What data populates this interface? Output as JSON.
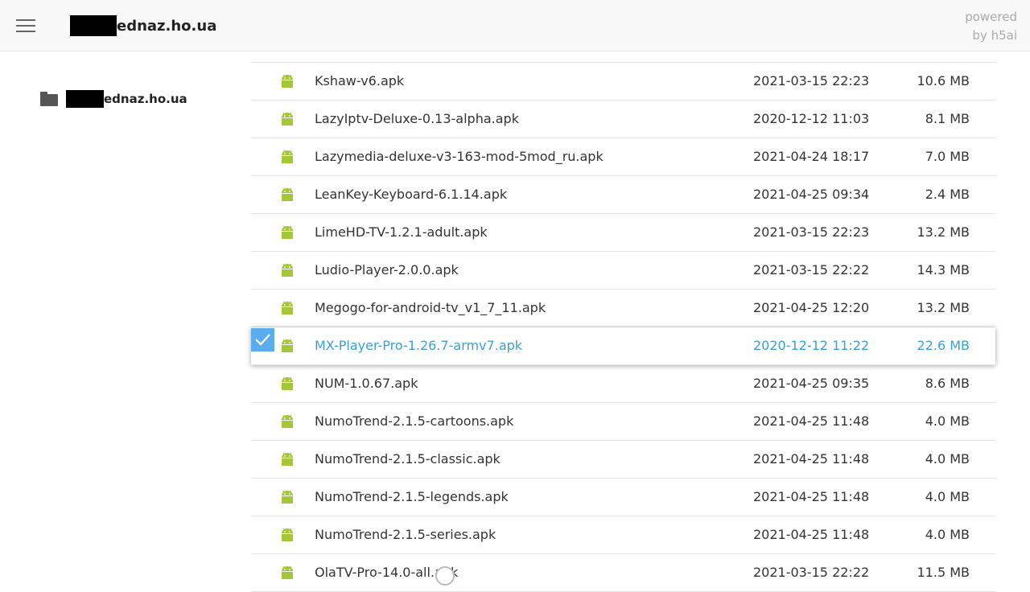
{
  "header": {
    "crumb_text": "ednaz.ho.ua",
    "powered_line1": "powered",
    "powered_line2": "by h5ai",
    "menu_icon": "hamburger-menu-icon"
  },
  "sidebar": {
    "folder_label": "ednaz.ho.ua",
    "folder_icon": "folder-icon"
  },
  "colors": {
    "selected_text": "#3b9fd8",
    "checkbox": "#5aacec",
    "android_icon": "#a4c639"
  },
  "files": [
    {
      "name": "Kshaw-v6.apk",
      "date": "2021-03-15 22:23",
      "size": "10.6 MB"
    },
    {
      "name": "LazyIptv-Deluxe-0.13-alpha.apk",
      "date": "2020-12-12 11:03",
      "size": "8.1 MB"
    },
    {
      "name": "Lazymedia-deluxe-v3-163-mod-5mod_ru.apk",
      "date": "2021-04-24 18:17",
      "size": "7.0 MB"
    },
    {
      "name": "LeanKey-Keyboard-6.1.14.apk",
      "date": "2021-04-25 09:34",
      "size": "2.4 MB"
    },
    {
      "name": "LimeHD-TV-1.2.1-adult.apk",
      "date": "2021-03-15 22:23",
      "size": "13.2 MB"
    },
    {
      "name": "Ludio-Player-2.0.0.apk",
      "date": "2021-03-15 22:22",
      "size": "14.3 MB"
    },
    {
      "name": "Megogo-for-android-tv_v1_7_11.apk",
      "date": "2021-04-25 12:20",
      "size": "13.2 MB"
    },
    {
      "name": "MX-Player-Pro-1.26.7-armv7.apk",
      "date": "2020-12-12 11:22",
      "size": "22.6 MB",
      "selected": true
    },
    {
      "name": "NUM-1.0.67.apk",
      "date": "2021-04-25 09:35",
      "size": "8.6 MB"
    },
    {
      "name": "NumoTrend-2.1.5-cartoons.apk",
      "date": "2021-04-25 11:48",
      "size": "4.0 MB"
    },
    {
      "name": "NumoTrend-2.1.5-classic.apk",
      "date": "2021-04-25 11:48",
      "size": "4.0 MB"
    },
    {
      "name": "NumoTrend-2.1.5-legends.apk",
      "date": "2021-04-25 11:48",
      "size": "4.0 MB"
    },
    {
      "name": "NumoTrend-2.1.5-series.apk",
      "date": "2021-04-25 11:48",
      "size": "4.0 MB"
    },
    {
      "name": "OlaTV-Pro-14.0-all.apk",
      "date": "2021-03-15 22:22",
      "size": "11.5 MB"
    }
  ]
}
